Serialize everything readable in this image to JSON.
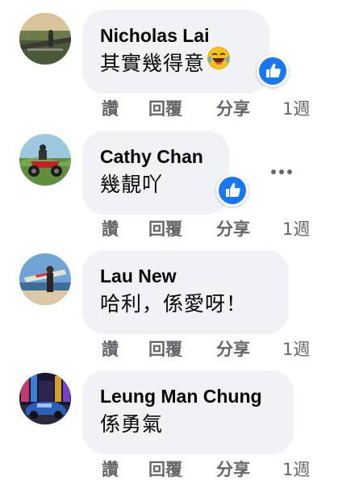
{
  "comments": [
    {
      "author": "Nicholas Lai",
      "text": "其實幾得意",
      "emoji": "laughing-emoji-icon",
      "reaction": "like",
      "actions": {
        "like": "讚",
        "reply": "回覆",
        "share": "分享"
      },
      "time": "1週"
    },
    {
      "author": "Cathy Chan",
      "text": "幾靚吖",
      "reaction": "like",
      "actions": {
        "like": "讚",
        "reply": "回覆",
        "share": "分享"
      },
      "time": "1週"
    },
    {
      "author": "Lau New",
      "text": "哈利，係愛呀！",
      "actions": {
        "like": "讚",
        "reply": "回覆",
        "share": "分享"
      },
      "time": "1週"
    },
    {
      "author": "Leung Man Chung",
      "text": "係勇氣",
      "actions": {
        "like": "讚",
        "reply": "回覆",
        "share": "分享"
      },
      "time": "1週"
    }
  ],
  "colors": {
    "bubble": "#f0f2f5",
    "secondary_text": "#65676b",
    "like_blue": "#1877f2"
  }
}
